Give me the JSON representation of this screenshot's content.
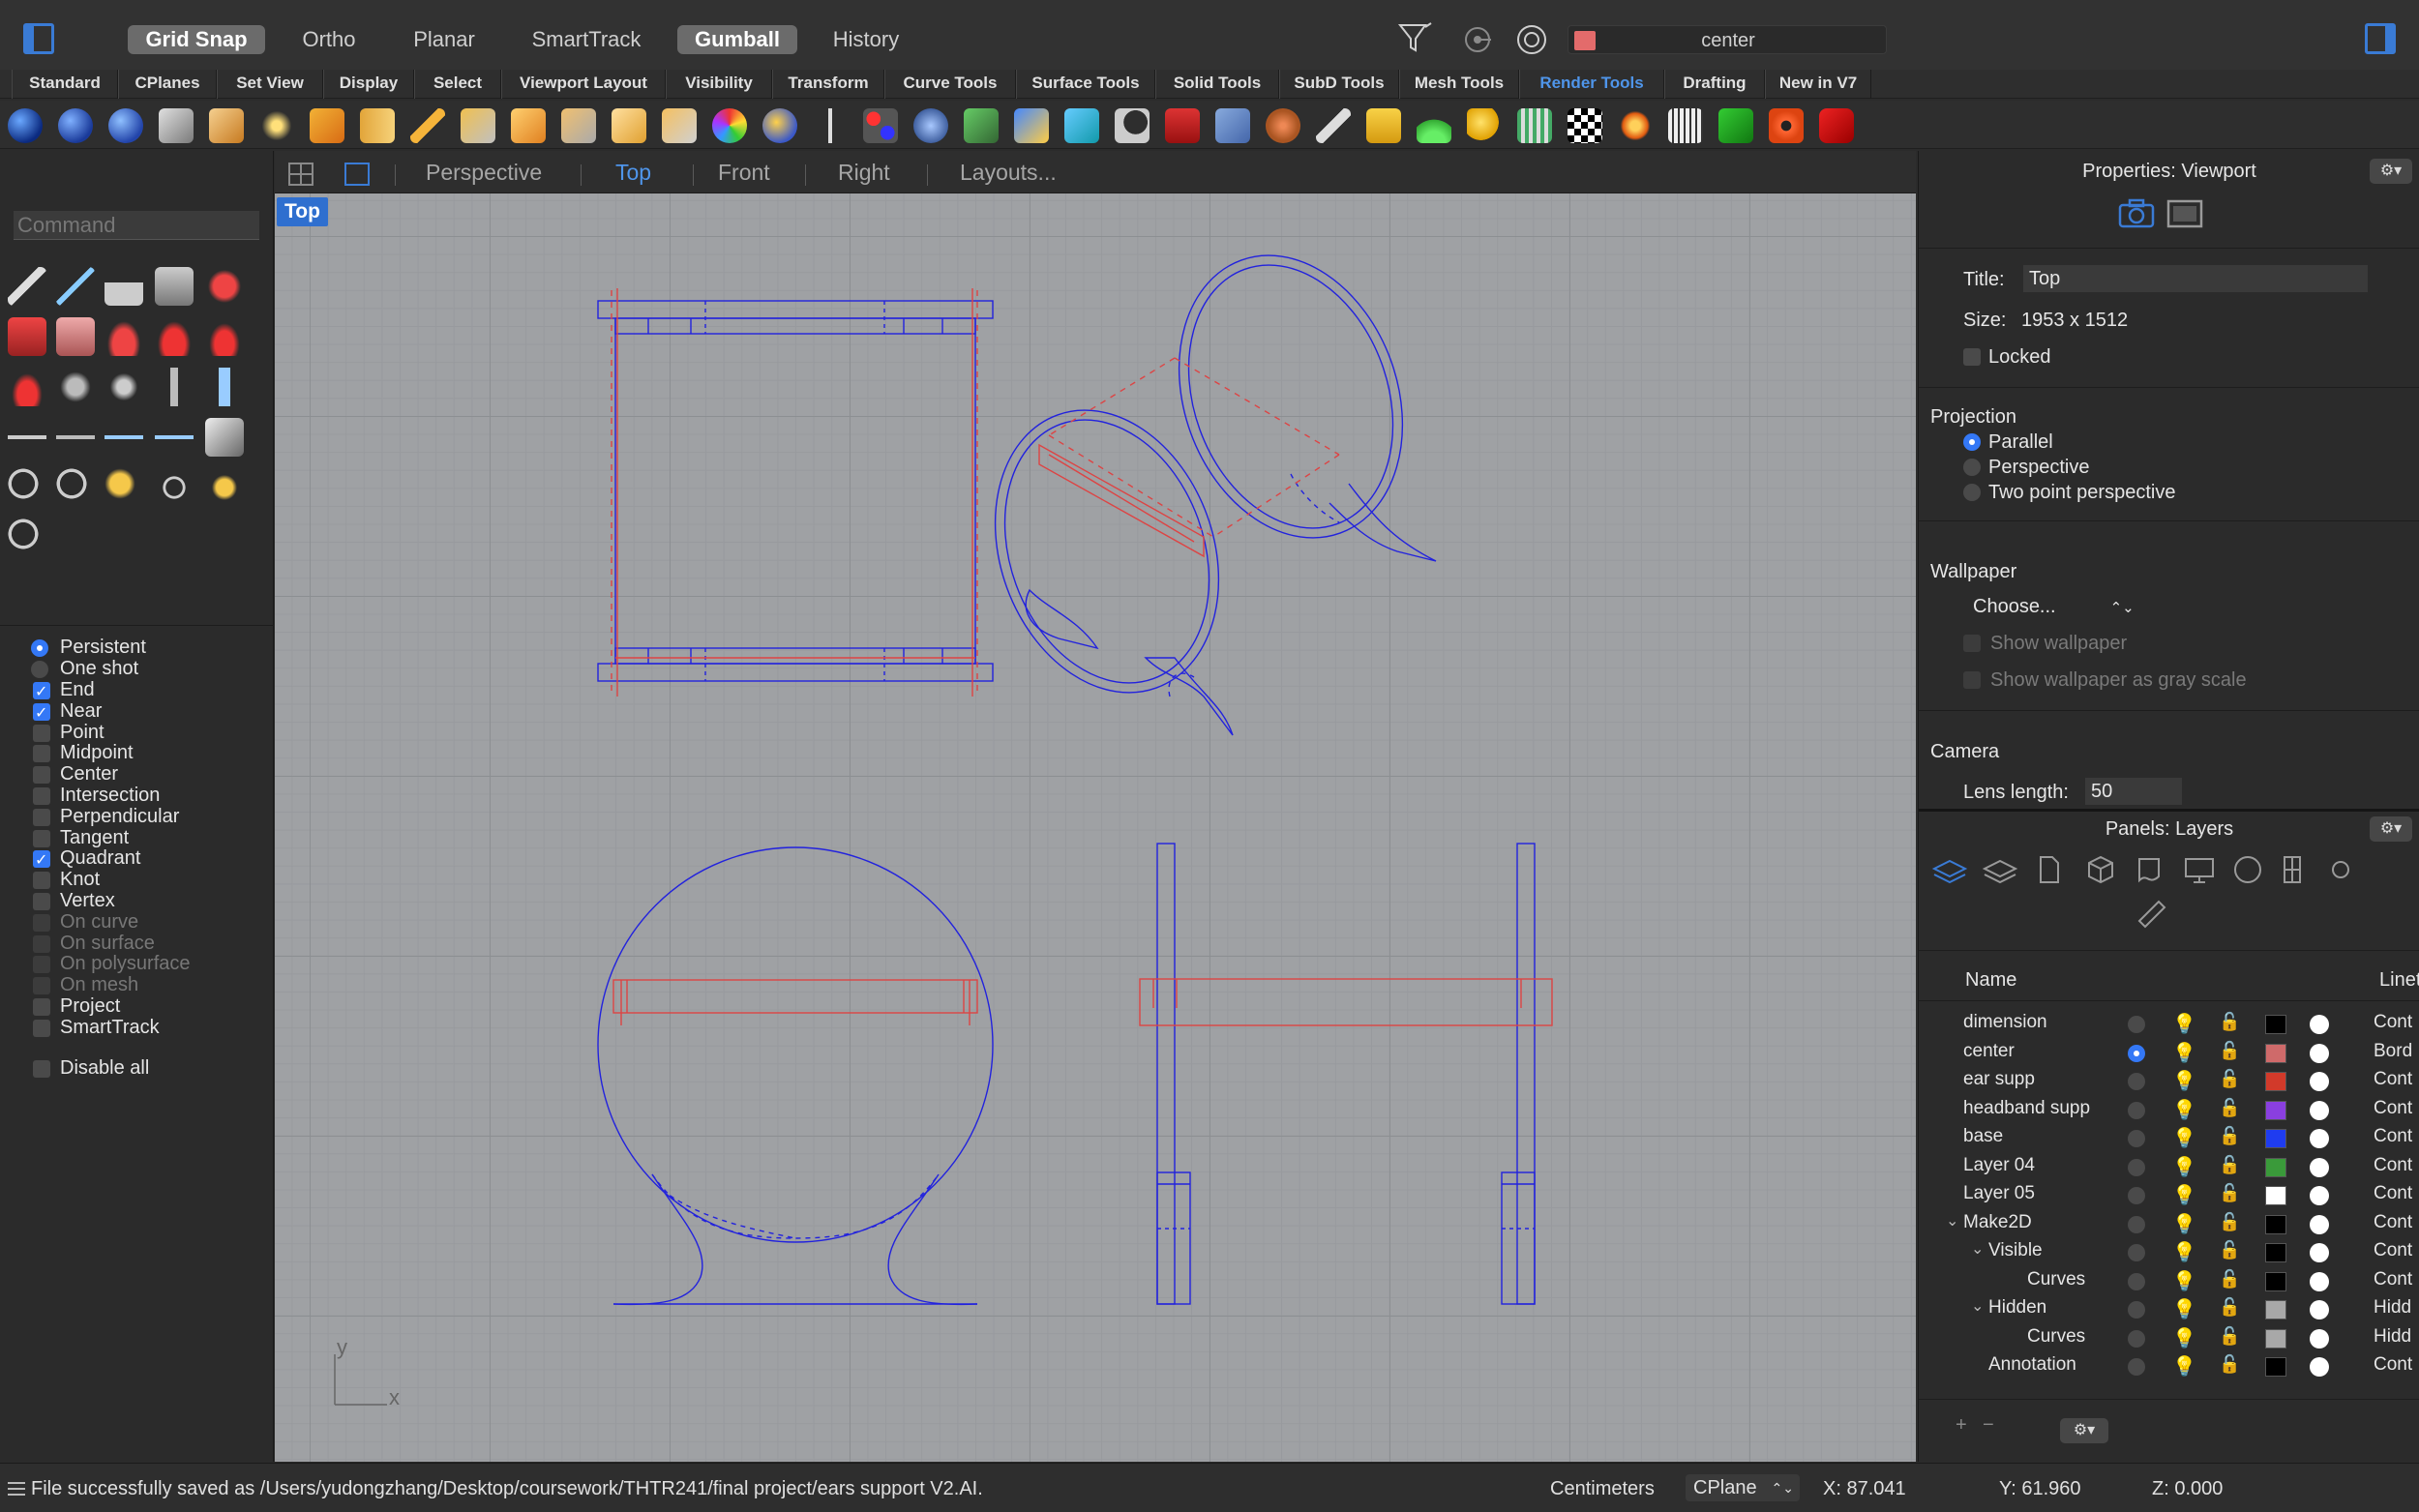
{
  "topbar": {
    "modes": [
      {
        "label": "Grid Snap",
        "active": true
      },
      {
        "label": "Ortho",
        "active": false
      },
      {
        "label": "Planar",
        "active": false
      },
      {
        "label": "SmartTrack",
        "active": false
      },
      {
        "label": "Gumball",
        "active": true
      },
      {
        "label": "History",
        "active": false
      }
    ],
    "current_layer": "center",
    "current_layer_color": "#e36b6b"
  },
  "tabs": [
    "Standard",
    "CPlanes",
    "Set View",
    "Display",
    "Select",
    "Viewport Layout",
    "Visibility",
    "Transform",
    "Curve Tools",
    "Surface Tools",
    "Solid Tools",
    "SubD Tools",
    "Mesh Tools",
    "Render Tools",
    "Drafting",
    "New in V7"
  ],
  "active_tab": "Render Tools",
  "command": {
    "placeholder": "Command"
  },
  "osnap": {
    "mode_persistent": "Persistent",
    "mode_oneshot": "One shot",
    "items": [
      {
        "label": "End",
        "checked": true,
        "enabled": true
      },
      {
        "label": "Near",
        "checked": true,
        "enabled": true
      },
      {
        "label": "Point",
        "checked": false,
        "enabled": true
      },
      {
        "label": "Midpoint",
        "checked": false,
        "enabled": true
      },
      {
        "label": "Center",
        "checked": false,
        "enabled": true
      },
      {
        "label": "Intersection",
        "checked": false,
        "enabled": true
      },
      {
        "label": "Perpendicular",
        "checked": false,
        "enabled": true
      },
      {
        "label": "Tangent",
        "checked": false,
        "enabled": true
      },
      {
        "label": "Quadrant",
        "checked": true,
        "enabled": true
      },
      {
        "label": "Knot",
        "checked": false,
        "enabled": true
      },
      {
        "label": "Vertex",
        "checked": false,
        "enabled": true
      },
      {
        "label": "On curve",
        "checked": false,
        "enabled": false
      },
      {
        "label": "On surface",
        "checked": false,
        "enabled": false
      },
      {
        "label": "On polysurface",
        "checked": false,
        "enabled": false
      },
      {
        "label": "On mesh",
        "checked": false,
        "enabled": false
      },
      {
        "label": "Project",
        "checked": false,
        "enabled": true
      },
      {
        "label": "SmartTrack",
        "checked": false,
        "enabled": true
      }
    ],
    "disable_all": "Disable all"
  },
  "viewport": {
    "tabs": [
      "Perspective",
      "Top",
      "Front",
      "Right",
      "Layouts..."
    ],
    "active": "Top",
    "label": "Top",
    "axis_x": "x",
    "axis_y": "y"
  },
  "properties": {
    "panel_title": "Properties: Viewport",
    "title_label": "Title:",
    "title_value": "Top",
    "size_label": "Size:",
    "size_value": "1953 x 1512",
    "locked_label": "Locked",
    "projection_heading": "Projection",
    "projection_options": [
      "Parallel",
      "Perspective",
      "Two point perspective"
    ],
    "projection_selected": "Parallel",
    "wallpaper_heading": "Wallpaper",
    "wallpaper_choose": "Choose...",
    "show_wallpaper": "Show wallpaper",
    "show_wallpaper_gray": "Show wallpaper as gray scale",
    "camera_heading": "Camera",
    "lens_label": "Lens length:",
    "lens_value": "50"
  },
  "layers": {
    "panel_title": "Panels: Layers",
    "col_name": "Name",
    "col_linetype": "Linet",
    "rows": [
      {
        "name": "dimension",
        "color": "#000000",
        "linetype": "Cont",
        "current": false,
        "indent": 0
      },
      {
        "name": "center",
        "color": "#cf6a6a",
        "linetype": "Bord",
        "current": true,
        "indent": 0
      },
      {
        "name": "ear supp",
        "color": "#d23a2a",
        "linetype": "Cont",
        "current": false,
        "indent": 0
      },
      {
        "name": "headband supp",
        "color": "#8a3fe0",
        "linetype": "Cont",
        "current": false,
        "indent": 0
      },
      {
        "name": "base",
        "color": "#1f3cf0",
        "linetype": "Cont",
        "current": false,
        "indent": 0
      },
      {
        "name": "Layer 04",
        "color": "#3a9a3a",
        "linetype": "Cont",
        "current": false,
        "indent": 0
      },
      {
        "name": "Layer 05",
        "color": "#ffffff",
        "linetype": "Cont",
        "current": false,
        "indent": 0
      },
      {
        "name": "Make2D",
        "color": "#000000",
        "linetype": "Cont",
        "current": false,
        "indent": 0,
        "expanded": true
      },
      {
        "name": "Visible",
        "color": "#000000",
        "linetype": "Cont",
        "current": false,
        "indent": 1,
        "expanded": true
      },
      {
        "name": "Curves",
        "color": "#000000",
        "linetype": "Cont",
        "current": false,
        "indent": 2
      },
      {
        "name": "Hidden",
        "color": "#a8a8a8",
        "linetype": "Hidd",
        "current": false,
        "indent": 1,
        "expanded": true
      },
      {
        "name": "Curves",
        "color": "#a8a8a8",
        "linetype": "Hidd",
        "current": false,
        "indent": 2
      },
      {
        "name": "Annotation",
        "color": "#000000",
        "linetype": "Cont",
        "current": false,
        "indent": 1
      }
    ]
  },
  "status": {
    "message": "File successfully saved as /Users/yudongzhang/Desktop/coursework/THTR241/final project/ears support V2.AI.",
    "units": "Centimeters",
    "cplane": "CPlane",
    "x": "X: 87.041",
    "y": "Y: 61.960",
    "z": "Z: 0.000"
  },
  "colors": {
    "accent": "#3a7bd5",
    "curve_blue": "#2222dd",
    "curve_red": "#dd4444"
  }
}
